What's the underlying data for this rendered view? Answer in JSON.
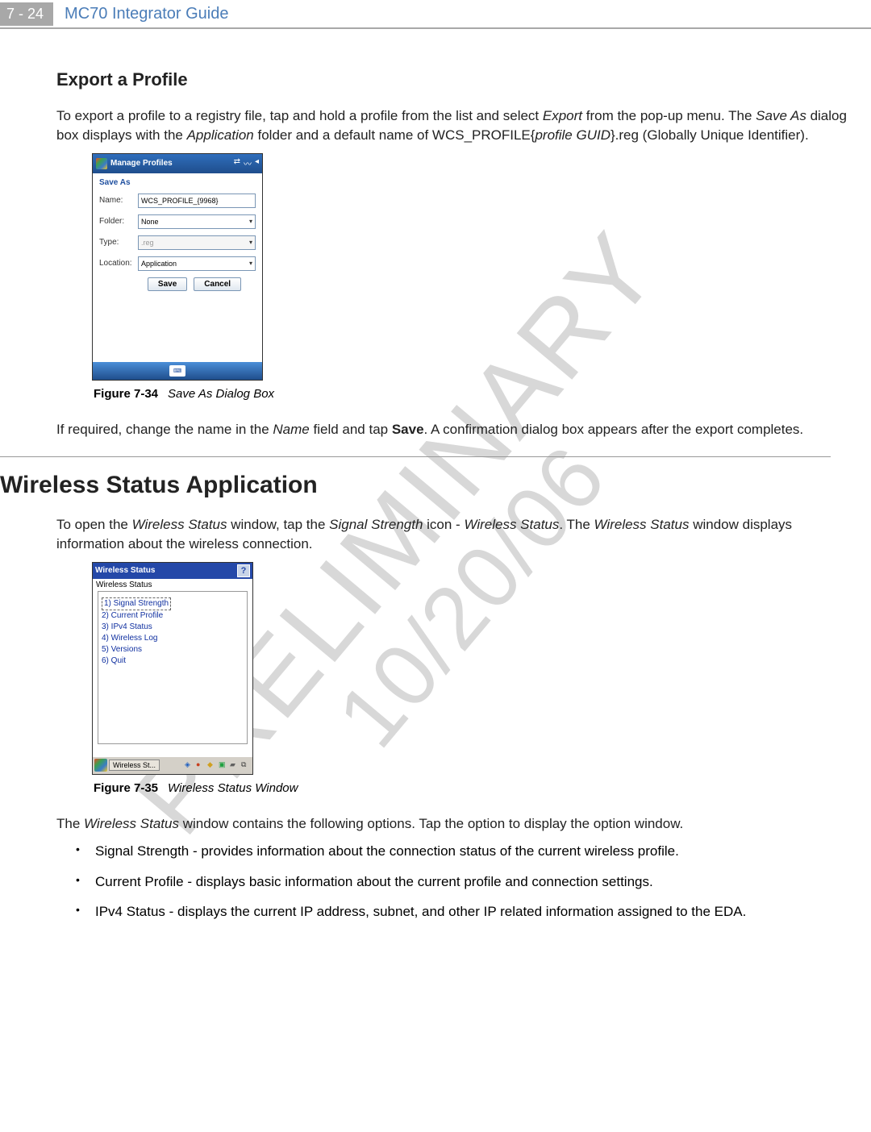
{
  "header": {
    "page_ref": "7 - 24",
    "guide_title": "MC70 Integrator Guide"
  },
  "section1": {
    "title": "Export a Profile",
    "para1_parts": {
      "t1": "To export a profile to a registry file, tap and hold a profile from the list and select ",
      "i1": "Export",
      "t2": " from the pop-up menu. The ",
      "i2": "Save As",
      "t3": " dialog box displays with the ",
      "i3": "Application",
      "t4": " folder and a default name of WCS_PROFILE{",
      "i4": "profile GUID",
      "t5": "}.reg (Globally Unique Identifier)."
    },
    "figure_label": "Figure 7-34",
    "figure_caption": "Save As Dialog Box",
    "para2_parts": {
      "t1": "If required, change the name in the ",
      "i1": "Name",
      "t2": " field and tap ",
      "b1": "Save",
      "t3": ". A confirmation dialog box appears after the export completes."
    }
  },
  "saveAsDialog": {
    "titlebar": "Manage Profiles",
    "heading": "Save As",
    "rows": {
      "name_label": "Name:",
      "name_value": "WCS_PROFILE_{9968}",
      "folder_label": "Folder:",
      "folder_value": "None",
      "type_label": "Type:",
      "type_value": ".reg",
      "location_label": "Location:",
      "location_value": "Application"
    },
    "buttons": {
      "save": "Save",
      "cancel": "Cancel"
    }
  },
  "section2": {
    "title": "Wireless Status Application",
    "para1_parts": {
      "t1": "To open the ",
      "i1": "Wireless Status",
      "t2": " window, tap the ",
      "i2": "Signal Strength",
      "t3": " icon - ",
      "i3": "Wireless Status",
      "t4": ". The ",
      "i4": "Wireless Status",
      "t5": " window displays information about the wireless connection."
    },
    "figure_label": "Figure 7-35",
    "figure_caption": "Wireless Status Window",
    "para2_parts": {
      "t1": "The ",
      "i1": "Wireless Status",
      "t2": " window contains the following options. Tap the option to display the option window."
    },
    "bullets": [
      "Signal Strength - provides information about the connection status of the current wireless profile.",
      "Current Profile - displays basic information about the current profile and connection settings.",
      "IPv4 Status - displays the current IP address, subnet, and other IP related information assigned to the EDA."
    ]
  },
  "wirelessStatus": {
    "titlebar": "Wireless Status",
    "subtitle": "Wireless Status",
    "items": [
      "1) Signal Strength",
      "2) Current Profile",
      "3) IPv4 Status",
      "4) Wireless Log",
      "5) Versions",
      "6) Quit"
    ],
    "taskbar_item": "Wireless St..."
  },
  "watermark": {
    "line1": "PRELIMINARY",
    "line2": "10/20/06"
  }
}
